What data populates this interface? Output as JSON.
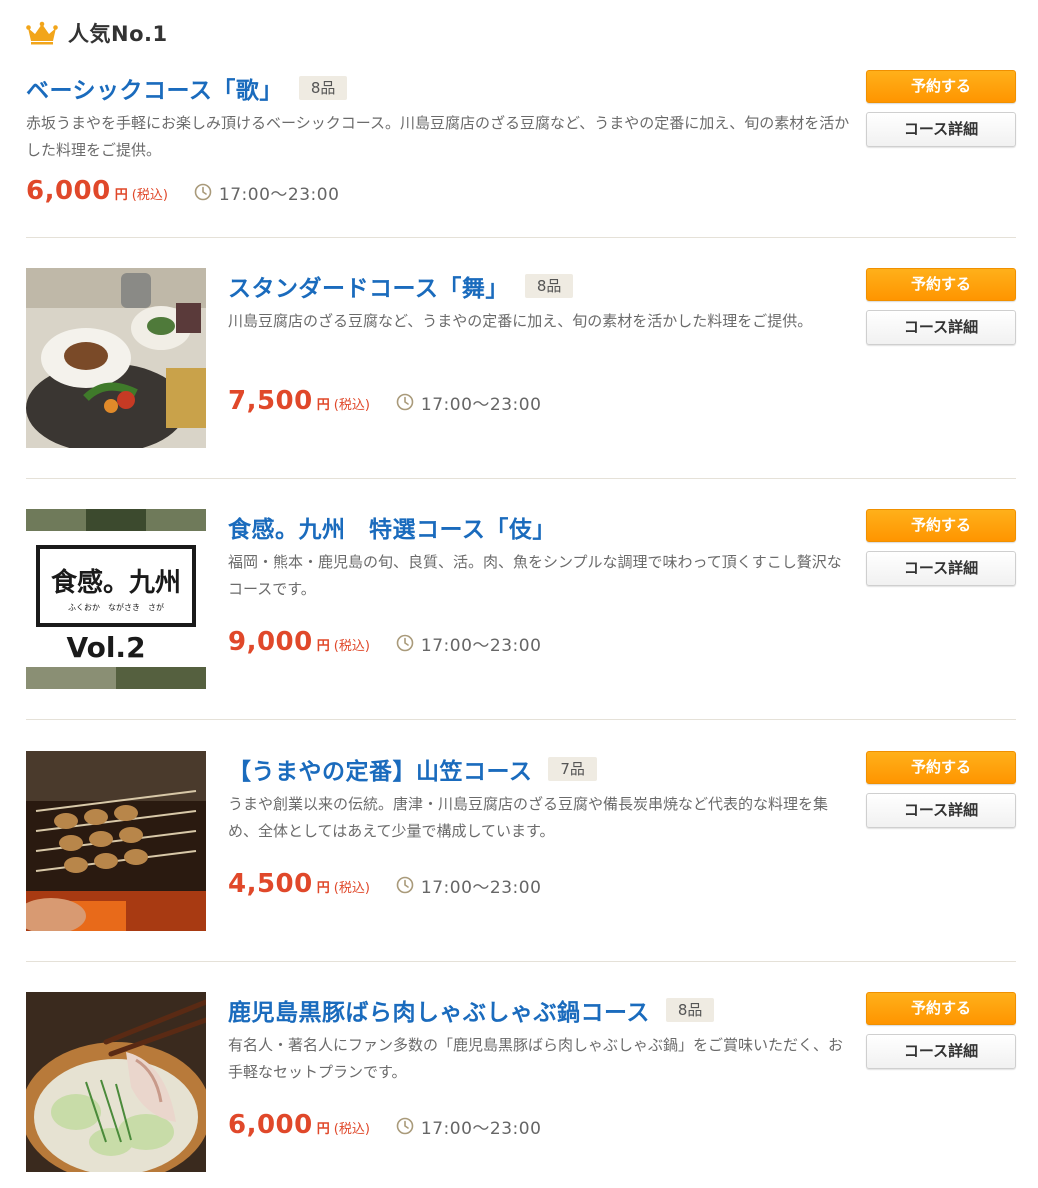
{
  "header": {
    "rank_label": "人気No.1",
    "icon": "crown-icon"
  },
  "colors": {
    "title": "#1a6bbd",
    "price": "#e0482a",
    "reserve_button": "#ff9500",
    "badge_bg": "#efebe2"
  },
  "courses": [
    {
      "title": "ベーシックコース「歌」",
      "count": "8品",
      "description": "赤坂うまやを手軽にお楽しみ頂けるベーシックコース。川島豆腐店のざる豆腐など、うまやの定番に加え、旬の素材を活かした料理をご提供。",
      "price": "6,000",
      "yen": "円",
      "tax": "(税込)",
      "hours": "17:00〜23:00",
      "reserve_label": "予約する",
      "detail_label": "コース詳細"
    },
    {
      "title": "スタンダードコース「舞」",
      "count": "8品",
      "description": "川島豆腐店のざる豆腐など、うまやの定番に加え、旬の素材を活かした料理をご提供。",
      "price": "7,500",
      "yen": "円",
      "tax": "(税込)",
      "hours": "17:00〜23:00",
      "reserve_label": "予約する",
      "detail_label": "コース詳細",
      "image": "course-dishes-photo"
    },
    {
      "title": "食感。九州　特選コース「伎」",
      "count": "",
      "description": "福岡・熊本・鹿児島の旬、良質、活。肉、魚をシンプルな調理で味わって頂くすこし贅沢なコースです。",
      "price": "9,000",
      "yen": "円",
      "tax": "(税込)",
      "hours": "17:00〜23:00",
      "reserve_label": "予約する",
      "detail_label": "コース詳細",
      "image": "kyushu-vol2-banner",
      "banner_title": "食感。九州",
      "banner_sub": "ふくおか　ながさき　さが",
      "banner_vol": "Vol.2"
    },
    {
      "title": "【うまやの定番】山笠コース",
      "count": "7品",
      "description": "うまや創業以来の伝統。唐津・川島豆腐店のざる豆腐や備長炭串焼など代表的な料理を集め、全体としてはあえて少量で構成しています。",
      "price": "4,500",
      "yen": "円",
      "tax": "(税込)",
      "hours": "17:00〜23:00",
      "reserve_label": "予約する",
      "detail_label": "コース詳細",
      "image": "yakitori-grill-photo"
    },
    {
      "title": "鹿児島黒豚ばら肉しゃぶしゃぶ鍋コース",
      "count": "8品",
      "description": "有名人・著名人にファン多数の「鹿児島黒豚ばら肉しゃぶしゃぶ鍋」をご賞味いただく、お手軽なセットプランです。",
      "price": "6,000",
      "yen": "円",
      "tax": "(税込)",
      "hours": "17:00〜23:00",
      "reserve_label": "予約する",
      "detail_label": "コース詳細",
      "image": "shabu-shabu-pot-photo"
    }
  ]
}
